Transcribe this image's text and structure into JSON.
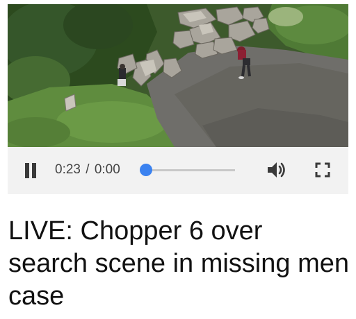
{
  "video": {
    "description_icon": "video-frame",
    "is_playing": true
  },
  "player": {
    "current_time": "0:23",
    "separator": "/",
    "duration": "0:00",
    "progress_fraction": 0,
    "accent_color": "#3b82f0",
    "icons": {
      "pause": "pause-icon",
      "volume": "volume-icon",
      "fullscreen": "fullscreen-icon"
    }
  },
  "article": {
    "headline": "LIVE: Chopper 6 over search scene in missing men case"
  }
}
